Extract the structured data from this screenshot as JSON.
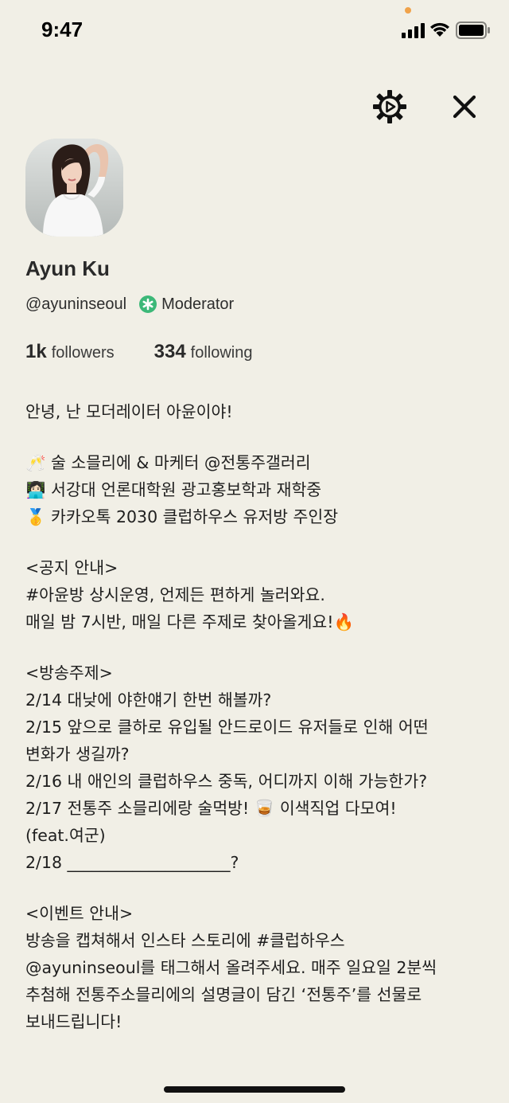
{
  "status_bar": {
    "time": "9:47"
  },
  "actions": {
    "settings_icon": "gear-icon",
    "close_icon": "close-icon"
  },
  "profile": {
    "name": "Ayun Ku",
    "handle": "@ayuninseoul",
    "badge_label": "Moderator",
    "badge_color": "#3cb878",
    "followers_count": "1k",
    "followers_label": "followers",
    "following_count": "334",
    "following_label": "following"
  },
  "bio": {
    "greeting": "안녕, 난 모더레이터 아윤이야!",
    "intro": [
      {
        "emoji": "🥂",
        "text": "술 소믈리에 & 마케터 @전통주갤러리"
      },
      {
        "emoji": "👩🏻‍💻",
        "text": "서강대 언론대학원 광고홍보학과 재학중"
      },
      {
        "emoji": "🥇",
        "text": "카카오톡 2030 클럽하우스 유저방 주인장"
      }
    ],
    "notice_header": "<공지 안내>",
    "notice_lines": [
      "#아윤방 상시운영, 언제든 편하게 놀러와요.",
      "매일 밤 7시반, 매일 다른 주제로 찾아올게요!🔥"
    ],
    "topics_header": "<방송주제>",
    "topics": [
      "2/14 대낮에 야한얘기 한번 해볼까?",
      "2/15 앞으로 클하로 유입될 안드로이드 유저들로 인해 어떤",
      "변화가 생길까?",
      "2/16 내 애인의 클럽하우스 중독, 어디까지 이해 가능한가?",
      "2/17 전통주 소믈리에랑 술먹방! 🥃 이색직업 다모여!",
      "(feat.여군)",
      "2/18 ____________________?"
    ],
    "event_header": "<이벤트 안내>",
    "event_lines": [
      "방송을 캡쳐해서 인스타 스토리에 #클럽하우스",
      "@ayuninseoul를 태그해서 올려주세요. 매주 일요일 2분씩",
      "추첨해 전통주소믈리에의 설명글이 담긴 ‘전통주’를 선물로",
      "보내드립니다!"
    ]
  },
  "theme": {
    "background": "#f1efe6",
    "text": "#1f1f1f"
  }
}
